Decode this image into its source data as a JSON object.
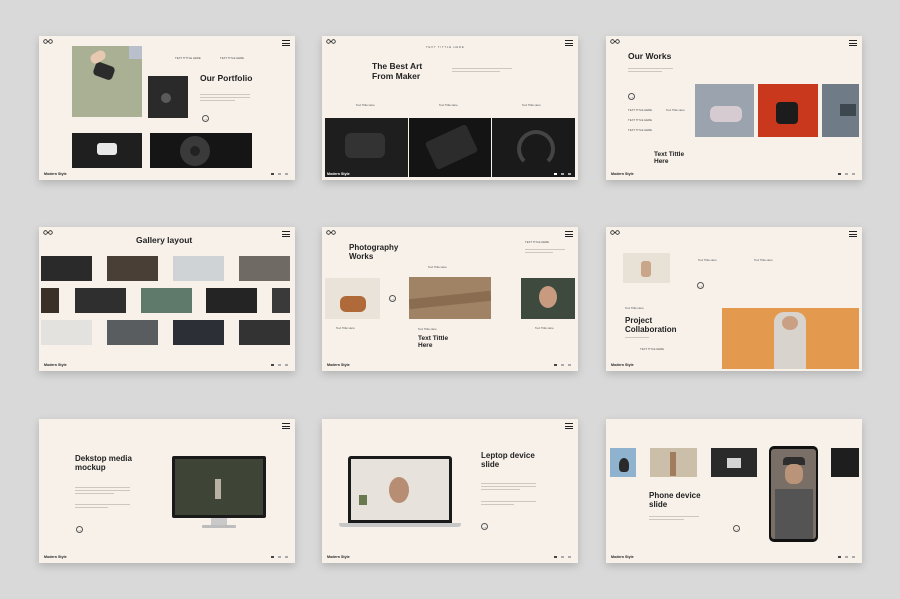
{
  "brand": "Modern Style",
  "slides": {
    "s1": {
      "title": "Our Portfolio",
      "small1": "TEXT TITTLE HERE",
      "small2": "TEXT TITLE HERE"
    },
    "s2": {
      "title": "The Best Art From Maker",
      "kicker": "TEXT TITTLE HERE",
      "col1": "Text Tittle Here",
      "col2": "Text Tittle Here",
      "col3": "Text Tittle Here"
    },
    "s3": {
      "title": "Our Works",
      "sub": "Text Tittle Here",
      "item1": "TEXT TITLE HERE",
      "item2": "TEXT TITLE HERE",
      "item3": "TEXT TITLE HERE",
      "item4": "Text Tittle Here"
    },
    "s4": {
      "title": "Gallery layout"
    },
    "s5": {
      "title": "Photography Works",
      "kicker": "TEXT TITLE HERE",
      "cap1": "Text Tittle Here",
      "cap2": "Text Tittle Here",
      "cap3": "Text Tittle Here",
      "cap4": "Text Tittle Here",
      "sub": "Text Tittle Here"
    },
    "s6": {
      "title": "Project Collaboration",
      "kicker": "Text Tittle Here",
      "cap1": "Text Tittle Here",
      "cap2": "TEXT TITLE HERE"
    },
    "s7": {
      "title": "Dekstop media mockup"
    },
    "s8": {
      "title": "Leptop device slide"
    },
    "s9": {
      "title": "Phone device slide"
    }
  },
  "colors": {
    "background": "#d9d9d9",
    "slide": "#f7f1ea",
    "text": "#222222"
  }
}
